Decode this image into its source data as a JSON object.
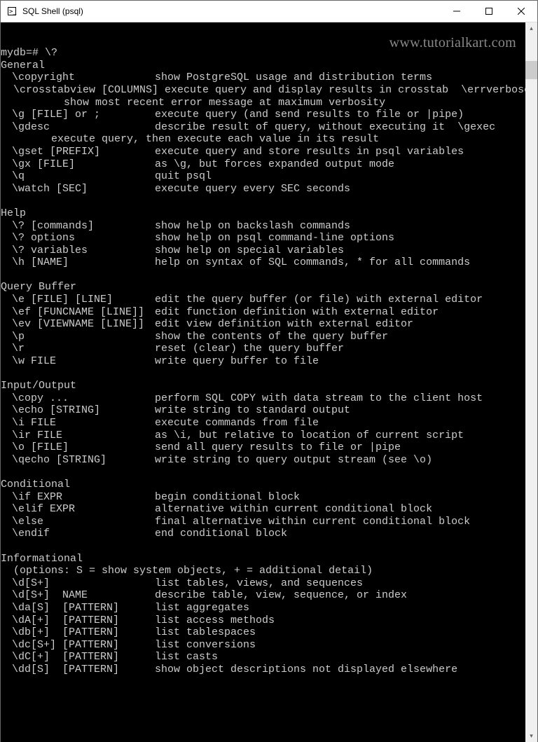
{
  "window": {
    "title": "SQL Shell (psql)"
  },
  "watermark": "www.tutorialkart.com",
  "prompt": "mydb=# \\?",
  "sections": [
    {
      "name": "General",
      "items": [
        {
          "cmd": "\\copyright",
          "desc": "show PostgreSQL usage and distribution terms"
        },
        {
          "cmd_full": "  \\crosstabview [COLUMNS] execute query and display results in crosstab  \\errverbose"
        },
        {
          "cont": "          show most recent error message at maximum verbosity"
        },
        {
          "cmd": "\\g [FILE] or ;",
          "desc": "execute query (and send results to file or |pipe)"
        },
        {
          "cmd": "\\gdesc",
          "desc": "describe result of query, without executing it  \\gexec"
        },
        {
          "cont": "        execute query, then execute each value in its result"
        },
        {
          "cmd": "\\gset [PREFIX]",
          "desc": "execute query and store results in psql variables"
        },
        {
          "cmd": "\\gx [FILE]",
          "desc": "as \\g, but forces expanded output mode"
        },
        {
          "cmd": "\\q",
          "desc": "quit psql"
        },
        {
          "cmd": "\\watch [SEC]",
          "desc": "execute query every SEC seconds"
        }
      ]
    },
    {
      "name": "Help",
      "items": [
        {
          "cmd": "\\? [commands]",
          "desc": "show help on backslash commands"
        },
        {
          "cmd": "\\? options",
          "desc": "show help on psql command-line options"
        },
        {
          "cmd": "\\? variables",
          "desc": "show help on special variables"
        },
        {
          "cmd": "\\h [NAME]",
          "desc": "help on syntax of SQL commands, * for all commands"
        }
      ]
    },
    {
      "name": "Query Buffer",
      "items": [
        {
          "cmd": "\\e [FILE] [LINE]",
          "desc": "edit the query buffer (or file) with external editor"
        },
        {
          "cmd": "\\ef [FUNCNAME [LINE]]",
          "desc": "edit function definition with external editor"
        },
        {
          "cmd": "\\ev [VIEWNAME [LINE]]",
          "desc": "edit view definition with external editor"
        },
        {
          "cmd": "\\p",
          "desc": "show the contents of the query buffer"
        },
        {
          "cmd": "\\r",
          "desc": "reset (clear) the query buffer"
        },
        {
          "cmd": "\\w FILE",
          "desc": "write query buffer to file"
        }
      ]
    },
    {
      "name": "Input/Output",
      "items": [
        {
          "cmd": "\\copy ...",
          "desc": "perform SQL COPY with data stream to the client host"
        },
        {
          "cmd": "\\echo [STRING]",
          "desc": "write string to standard output"
        },
        {
          "cmd": "\\i FILE",
          "desc": "execute commands from file"
        },
        {
          "cmd": "\\ir FILE",
          "desc": "as \\i, but relative to location of current script"
        },
        {
          "cmd": "\\o [FILE]",
          "desc": "send all query results to file or |pipe"
        },
        {
          "cmd": "\\qecho [STRING]",
          "desc": "write string to query output stream (see \\o)"
        }
      ]
    },
    {
      "name": "Conditional",
      "items": [
        {
          "cmd": "\\if EXPR",
          "desc": "begin conditional block"
        },
        {
          "cmd": "\\elif EXPR",
          "desc": "alternative within current conditional block"
        },
        {
          "cmd": "\\else",
          "desc": "final alternative within current conditional block"
        },
        {
          "cmd": "\\endif",
          "desc": "end conditional block"
        }
      ]
    },
    {
      "name": "Informational",
      "note": "  (options: S = show system objects, + = additional detail)",
      "items": [
        {
          "cmd": "\\d[S+]",
          "desc": "list tables, views, and sequences"
        },
        {
          "cmd": "\\d[S+]  NAME",
          "desc": "describe table, view, sequence, or index"
        },
        {
          "cmd": "\\da[S]  [PATTERN]",
          "desc": "list aggregates"
        },
        {
          "cmd": "\\dA[+]  [PATTERN]",
          "desc": "list access methods"
        },
        {
          "cmd": "\\db[+]  [PATTERN]",
          "desc": "list tablespaces"
        },
        {
          "cmd": "\\dc[S+] [PATTERN]",
          "desc": "list conversions"
        },
        {
          "cmd": "\\dC[+]  [PATTERN]",
          "desc": "list casts"
        },
        {
          "cmd": "\\dd[S]  [PATTERN]",
          "desc": "show object descriptions not displayed elsewhere"
        }
      ]
    }
  ]
}
